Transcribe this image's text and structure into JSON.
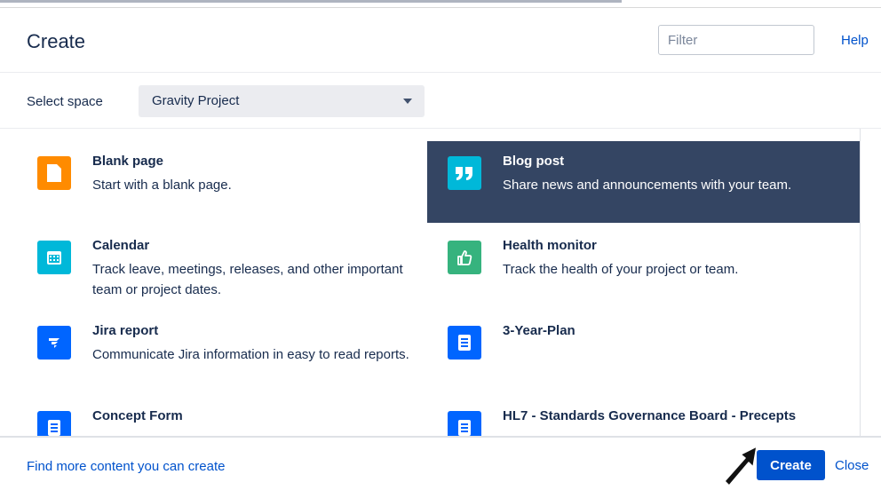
{
  "dialog": {
    "title": "Create",
    "help_label": "Help",
    "filter_placeholder": "Filter"
  },
  "space": {
    "label": "Select space",
    "selected": "Gravity Project"
  },
  "items": [
    {
      "name": "Blank page",
      "description": "Start with a blank page.",
      "icon": "blank-page-icon",
      "color": "#ff8b00"
    },
    {
      "name": "Blog post",
      "description": "Share news and announcements with your team.",
      "icon": "quote-icon",
      "color": "#00b8d9",
      "selected": true
    },
    {
      "name": "Calendar",
      "description": "Track leave, meetings, releases, and other important team or project dates.",
      "icon": "calendar-icon",
      "color": "#00b8d9"
    },
    {
      "name": "Health monitor",
      "description": "Track the health of your project or team.",
      "icon": "thumbs-up-icon",
      "color": "#36b37e"
    },
    {
      "name": "Jira report",
      "description": "Communicate Jira information in easy to read reports.",
      "icon": "jira-icon",
      "color": "#0065ff"
    },
    {
      "name": "3-Year-Plan",
      "description": "",
      "icon": "document-icon",
      "color": "#0065ff"
    },
    {
      "name": "Concept Form",
      "description": "",
      "icon": "document-icon",
      "color": "#0065ff"
    },
    {
      "name": "HL7 - Standards Governance Board - Precepts",
      "description": "",
      "icon": "document-icon",
      "color": "#0065ff"
    }
  ],
  "footer": {
    "find_more": "Find more content you can create",
    "create_label": "Create",
    "close_label": "Close"
  },
  "colors": {
    "accent": "#0052cc",
    "selected_bg": "#344563"
  }
}
